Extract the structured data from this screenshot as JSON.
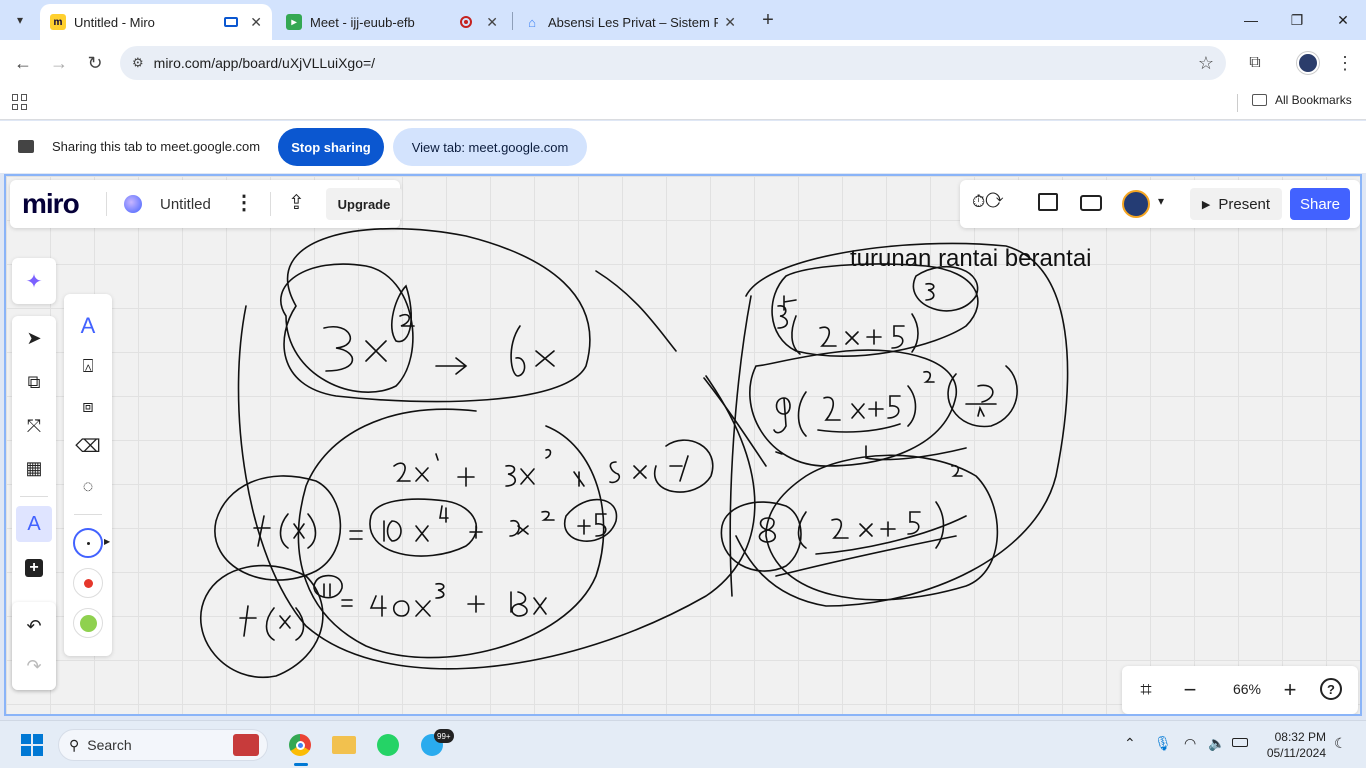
{
  "browser": {
    "tabs": [
      {
        "title": "Untitled - Miro",
        "active": true
      },
      {
        "title": "Meet - ijj-euub-efb",
        "active": false
      },
      {
        "title": "Absensi Les Privat – Sistem Rua",
        "active": false
      }
    ],
    "new_tab_symbol": "+",
    "url": "miro.com/app/board/uXjVLLuiXgo=/",
    "bookmarks_label": "All Bookmarks"
  },
  "share_bar": {
    "message": "Sharing this tab to meet.google.com",
    "stop_label": "Stop sharing",
    "view_label": "View tab: meet.google.com"
  },
  "miro": {
    "logo": "miro",
    "board_title": "Untitled",
    "upgrade_label": "Upgrade",
    "present_label": "Present",
    "share_label": "Share",
    "zoom": "66%",
    "help_symbol": "?",
    "board_text": "turunan rantai berantai"
  },
  "colors": {
    "accent": "#4262ff",
    "tab_strip": "#d3e3fd",
    "stop_sharing": "#0b57d0",
    "view_tab": "#d3e3fd",
    "red_dot": "#e5372b",
    "green_dot": "#8fd14f"
  },
  "taskbar": {
    "search_label": "Search",
    "telegram_badge": "99+",
    "time": "08:32 PM",
    "date": "05/11/2024"
  }
}
